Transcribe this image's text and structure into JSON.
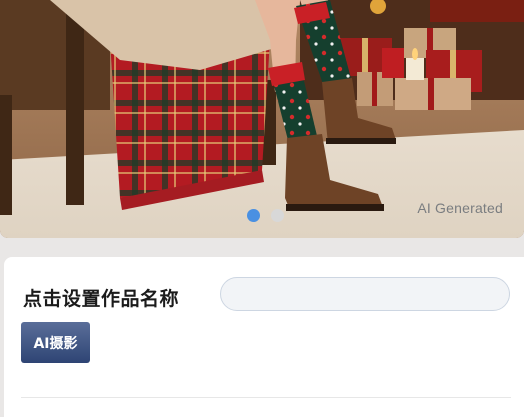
{
  "hero": {
    "watermark": "AI Generated",
    "slide_count": 2,
    "active_slide": 1
  },
  "form": {
    "title_label": "点击设置作品名称",
    "name_input_value": "",
    "name_input_placeholder": ""
  },
  "tag": {
    "label": "AI摄影"
  },
  "colors": {
    "active_dot": "#4a90e2",
    "inactive_dot": "#d8d8d8",
    "tag_bg": "#3b5283",
    "input_border": "#cdd6e2"
  }
}
